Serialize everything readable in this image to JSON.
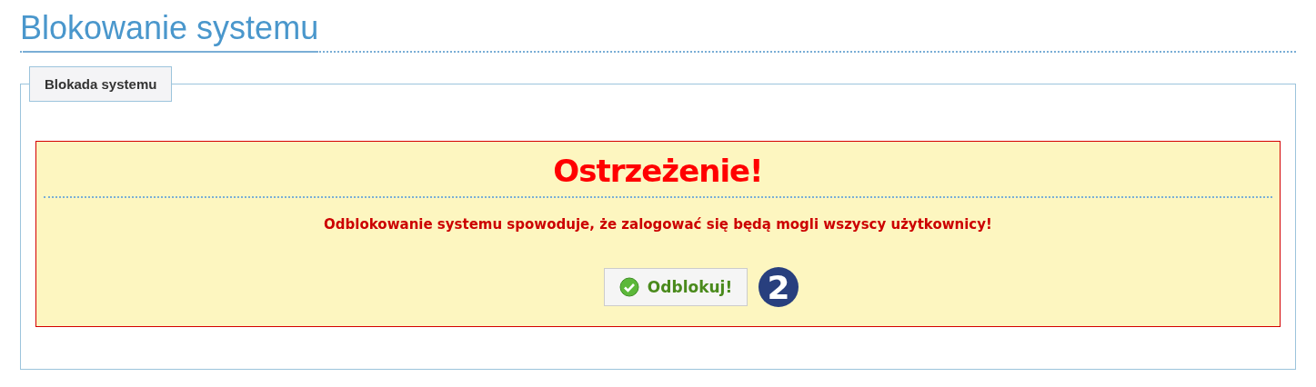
{
  "page": {
    "title": "Blokowanie systemu"
  },
  "panel": {
    "legend": "Blokada systemu"
  },
  "warning": {
    "heading": "Ostrzeżenie!",
    "message": "Odblokowanie systemu spowoduje, że zalogować się będą mogli wszyscy użytkownicy!"
  },
  "button": {
    "label": "Odblokuj!"
  },
  "step_badge": "2"
}
